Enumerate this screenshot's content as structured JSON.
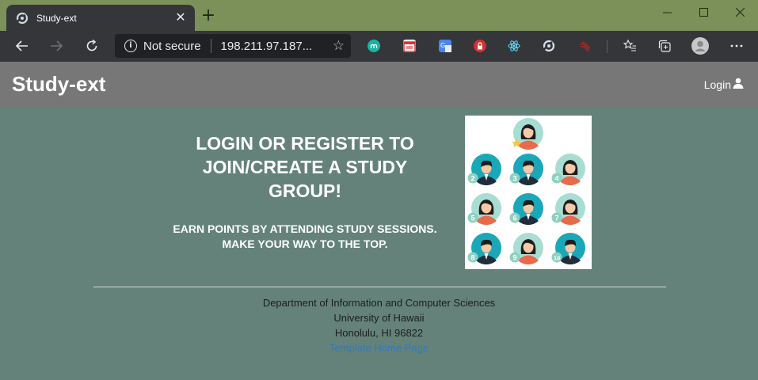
{
  "browser": {
    "tab": {
      "title": "Study-ext"
    },
    "address_bar": {
      "security_label": "Not secure",
      "url": "198.211.97.187..."
    }
  },
  "navbar": {
    "brand": "Study-ext",
    "login_label": "Login"
  },
  "hero": {
    "headline": "LOGIN OR REGISTER TO JOIN/CREATE A STUDY GROUP!",
    "subheadline_1": "EARN POINTS BY ATTENDING STUDY SESSIONS.",
    "subheadline_2": "MAKE YOUR WAY TO THE TOP."
  },
  "ranking_image": {
    "numbers": [
      "2",
      "3",
      "4",
      "5",
      "6",
      "7",
      "8",
      "9",
      "10"
    ]
  },
  "footer": {
    "line_1": "Department of Information and Computer Sciences",
    "line_2": "University of Hawaii",
    "line_3": "Honolulu, HI 96822",
    "link": "Template Home Page"
  },
  "colors": {
    "page_background": "#64827a",
    "navbar": "#777777",
    "title_bar": "#7b9159",
    "link": "#337ab7"
  }
}
